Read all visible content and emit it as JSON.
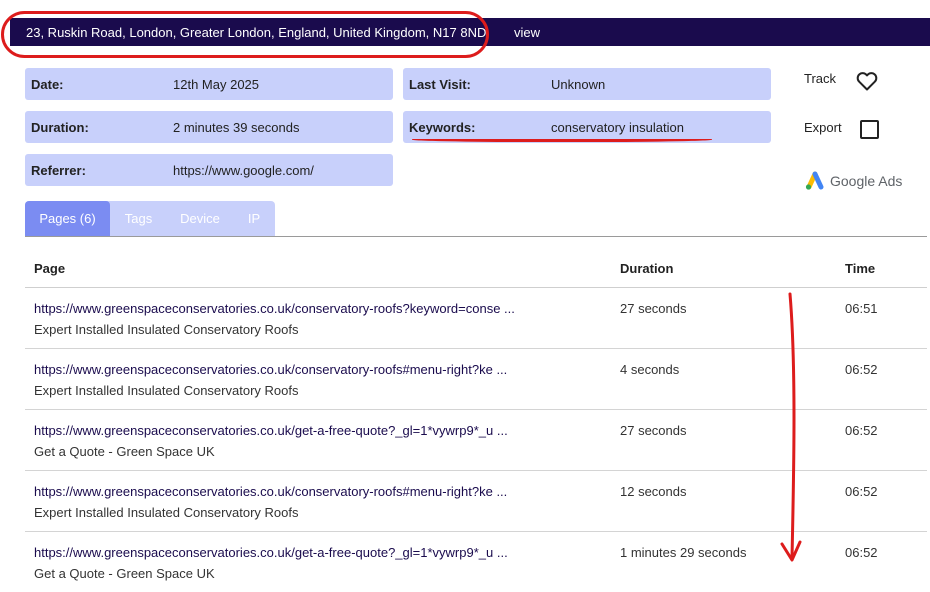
{
  "header": {
    "address": "23, Ruskin Road, London, Greater London, England, United Kingdom, N17 8ND",
    "view_label": "view"
  },
  "info": {
    "date_label": "Date:",
    "date_value": "12th May 2025",
    "last_visit_label": "Last Visit:",
    "last_visit_value": "Unknown",
    "duration_label": "Duration:",
    "duration_value": "2 minutes 39 seconds",
    "keywords_label": "Keywords:",
    "keywords_value": "conservatory insulation",
    "referrer_label": "Referrer:",
    "referrer_value": "https://www.google.com/"
  },
  "actions": {
    "track_label": "Track",
    "export_label": "Export",
    "google_ads_label": "Google Ads",
    "icons": [
      "heart-icon",
      "checkbox-icon",
      "google-ads-logo-icon"
    ]
  },
  "tabs": [
    {
      "label": "Pages (6)",
      "active": true
    },
    {
      "label": "Tags",
      "active": false
    },
    {
      "label": "Device",
      "active": false
    },
    {
      "label": "IP",
      "active": false
    }
  ],
  "table": {
    "headers": {
      "page": "Page",
      "duration": "Duration",
      "time": "Time"
    },
    "rows": [
      {
        "url": "https://www.greenspaceconservatories.co.uk/conservatory-roofs?keyword=conse ...",
        "title": "Expert Installed Insulated Conservatory Roofs",
        "duration": "27 seconds",
        "time": "06:51"
      },
      {
        "url": "https://www.greenspaceconservatories.co.uk/conservatory-roofs#menu-right?ke ...",
        "title": "Expert Installed Insulated Conservatory Roofs",
        "duration": "4 seconds",
        "time": "06:52"
      },
      {
        "url": "https://www.greenspaceconservatories.co.uk/get-a-free-quote?_gl=1*vywrp9*_u ...",
        "title": "Get a Quote - Green Space UK",
        "duration": "27 seconds",
        "time": "06:52"
      },
      {
        "url": "https://www.greenspaceconservatories.co.uk/conservatory-roofs#menu-right?ke ...",
        "title": "Expert Installed Insulated Conservatory Roofs",
        "duration": "12 seconds",
        "time": "06:52"
      },
      {
        "url": "https://www.greenspaceconservatories.co.uk/get-a-free-quote?_gl=1*vywrp9*_u ...",
        "title": "Get a Quote - Green Space UK",
        "duration": "1 minutes 29 seconds",
        "time": "06:52"
      }
    ]
  },
  "colors": {
    "header_bg": "#1a0b4d",
    "info_bg": "#c8d0fb",
    "tab_active": "#7b8cf2",
    "annotation_red": "#dd1c1c"
  }
}
